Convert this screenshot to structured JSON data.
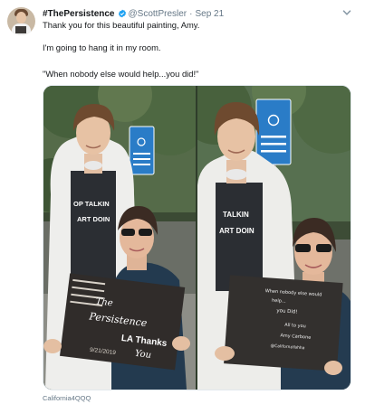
{
  "tweet": {
    "display_name": "#ThePersistence",
    "handle": "@ScottPresler",
    "separator": "·",
    "date": "Sep 21",
    "text_lines": [
      "Thank you for this beautiful painting, Amy.",
      "I'm going to hang it in my room.",
      "\"When nobody else would help...you did!\""
    ],
    "media_caption": "California4QQQ"
  },
  "media": {
    "left_photo": {
      "shirt_text": [
        "OP TALKIN",
        "ART DOIN"
      ],
      "painting_text": [
        "The",
        "Persistence",
        "LA Thanks",
        "You",
        "9/21/2019"
      ]
    },
    "right_photo": {
      "shirt_text": [
        "TALKIN",
        "ART DOIN"
      ],
      "painting_text": [
        "When nobody else would",
        "help...",
        "you Did!",
        "All to you",
        "Amy Carbone",
        "@CalifornaYahha"
      ]
    }
  },
  "colors": {
    "verified": "#1da1f2",
    "secondary_text": "#657786",
    "primary_text": "#14171a",
    "border": "#e1e8ed"
  },
  "icons": {
    "verified": "verified-badge-icon",
    "caret": "chevron-down-icon"
  }
}
